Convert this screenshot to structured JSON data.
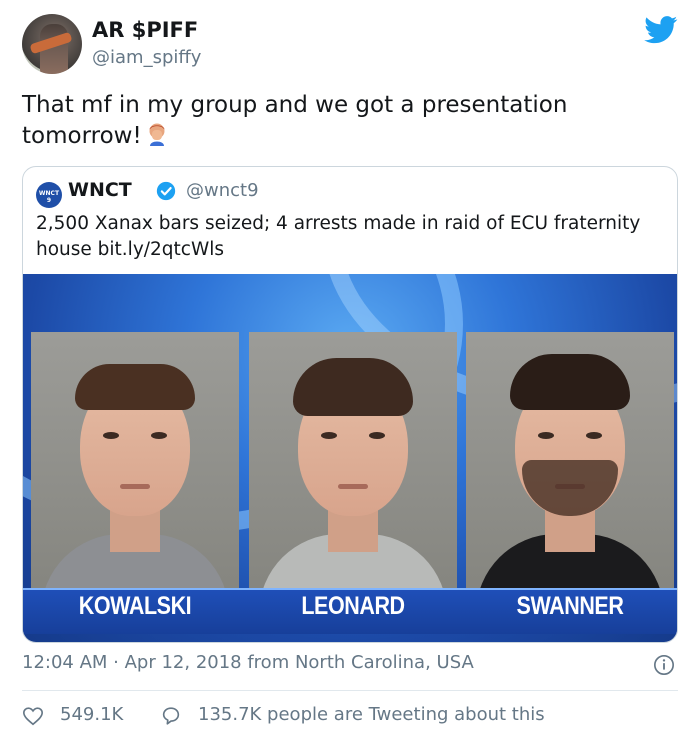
{
  "tweet": {
    "author": {
      "display_name": "AR $PIFF",
      "handle": "@iam_spiffy"
    },
    "text": "That mf in my group and we got a presentation tomorrow!",
    "emoji": "face-palm-emoji",
    "timestamp": "12:04 AM · Apr 12, 2018 from North Carolina, USA",
    "likes": "549.1K",
    "retweet_discussion": "135.7K people are Tweeting about this"
  },
  "quoted_tweet": {
    "author": {
      "display_name": "WNCT",
      "handle": "@wnct9",
      "verified": true,
      "avatar_text": "WNCT 9"
    },
    "text": "2,500 Xanax bars seized; 4 arrests made in raid of ECU fraternity house bit.ly/2qtcWls",
    "media": {
      "suspects": [
        {
          "name": "KOWALSKI"
        },
        {
          "name": "LEONARD"
        },
        {
          "name": "SWANNER"
        }
      ]
    }
  },
  "icons": [
    "twitter-bird-icon",
    "verified-badge-icon",
    "info-icon",
    "heart-icon",
    "speech-bubble-icon"
  ],
  "colors": {
    "twitter_blue": "#1da1f2",
    "muted_text": "#657786",
    "text": "#14171a",
    "border": "#ccd6dd",
    "news_band": "#1f4fb8"
  }
}
